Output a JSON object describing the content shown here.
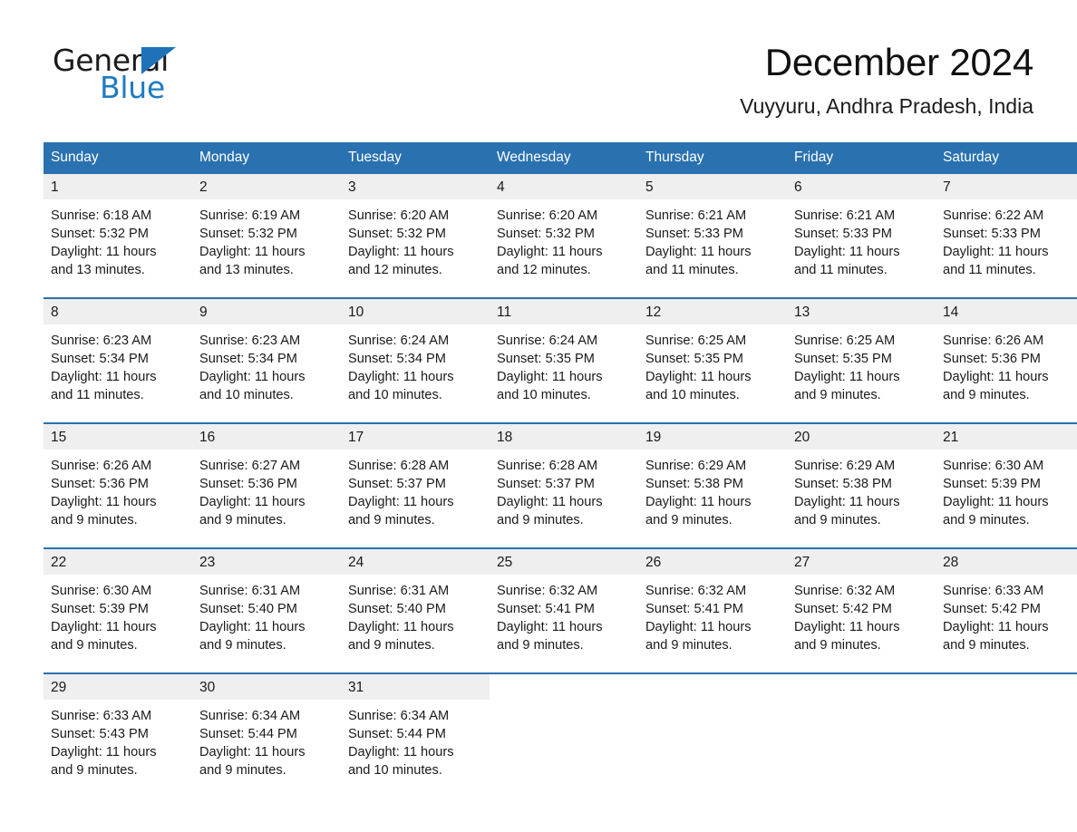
{
  "brand": {
    "word_general": "General",
    "word_blue": "Blue",
    "triangle_color": "#1f72b8",
    "blue_color": "#1f7ac2"
  },
  "header": {
    "title": "December 2024",
    "subtitle": "Vuyyuru, Andhra Pradesh, India"
  },
  "colors": {
    "header_blue": "#2a71b0",
    "daynum_gray": "#efefef",
    "row_divider": "#2a71b0"
  },
  "calendar": {
    "weekday_headers": [
      "Sunday",
      "Monday",
      "Tuesday",
      "Wednesday",
      "Thursday",
      "Friday",
      "Saturday"
    ],
    "weeks": [
      [
        {
          "day": "1",
          "sunrise": "Sunrise: 6:18 AM",
          "sunset": "Sunset: 5:32 PM",
          "daylight_1": "Daylight: 11 hours",
          "daylight_2": "and 13 minutes."
        },
        {
          "day": "2",
          "sunrise": "Sunrise: 6:19 AM",
          "sunset": "Sunset: 5:32 PM",
          "daylight_1": "Daylight: 11 hours",
          "daylight_2": "and 13 minutes."
        },
        {
          "day": "3",
          "sunrise": "Sunrise: 6:20 AM",
          "sunset": "Sunset: 5:32 PM",
          "daylight_1": "Daylight: 11 hours",
          "daylight_2": "and 12 minutes."
        },
        {
          "day": "4",
          "sunrise": "Sunrise: 6:20 AM",
          "sunset": "Sunset: 5:32 PM",
          "daylight_1": "Daylight: 11 hours",
          "daylight_2": "and 12 minutes."
        },
        {
          "day": "5",
          "sunrise": "Sunrise: 6:21 AM",
          "sunset": "Sunset: 5:33 PM",
          "daylight_1": "Daylight: 11 hours",
          "daylight_2": "and 11 minutes."
        },
        {
          "day": "6",
          "sunrise": "Sunrise: 6:21 AM",
          "sunset": "Sunset: 5:33 PM",
          "daylight_1": "Daylight: 11 hours",
          "daylight_2": "and 11 minutes."
        },
        {
          "day": "7",
          "sunrise": "Sunrise: 6:22 AM",
          "sunset": "Sunset: 5:33 PM",
          "daylight_1": "Daylight: 11 hours",
          "daylight_2": "and 11 minutes."
        }
      ],
      [
        {
          "day": "8",
          "sunrise": "Sunrise: 6:23 AM",
          "sunset": "Sunset: 5:34 PM",
          "daylight_1": "Daylight: 11 hours",
          "daylight_2": "and 11 minutes."
        },
        {
          "day": "9",
          "sunrise": "Sunrise: 6:23 AM",
          "sunset": "Sunset: 5:34 PM",
          "daylight_1": "Daylight: 11 hours",
          "daylight_2": "and 10 minutes."
        },
        {
          "day": "10",
          "sunrise": "Sunrise: 6:24 AM",
          "sunset": "Sunset: 5:34 PM",
          "daylight_1": "Daylight: 11 hours",
          "daylight_2": "and 10 minutes."
        },
        {
          "day": "11",
          "sunrise": "Sunrise: 6:24 AM",
          "sunset": "Sunset: 5:35 PM",
          "daylight_1": "Daylight: 11 hours",
          "daylight_2": "and 10 minutes."
        },
        {
          "day": "12",
          "sunrise": "Sunrise: 6:25 AM",
          "sunset": "Sunset: 5:35 PM",
          "daylight_1": "Daylight: 11 hours",
          "daylight_2": "and 10 minutes."
        },
        {
          "day": "13",
          "sunrise": "Sunrise: 6:25 AM",
          "sunset": "Sunset: 5:35 PM",
          "daylight_1": "Daylight: 11 hours",
          "daylight_2": "and 9 minutes."
        },
        {
          "day": "14",
          "sunrise": "Sunrise: 6:26 AM",
          "sunset": "Sunset: 5:36 PM",
          "daylight_1": "Daylight: 11 hours",
          "daylight_2": "and 9 minutes."
        }
      ],
      [
        {
          "day": "15",
          "sunrise": "Sunrise: 6:26 AM",
          "sunset": "Sunset: 5:36 PM",
          "daylight_1": "Daylight: 11 hours",
          "daylight_2": "and 9 minutes."
        },
        {
          "day": "16",
          "sunrise": "Sunrise: 6:27 AM",
          "sunset": "Sunset: 5:36 PM",
          "daylight_1": "Daylight: 11 hours",
          "daylight_2": "and 9 minutes."
        },
        {
          "day": "17",
          "sunrise": "Sunrise: 6:28 AM",
          "sunset": "Sunset: 5:37 PM",
          "daylight_1": "Daylight: 11 hours",
          "daylight_2": "and 9 minutes."
        },
        {
          "day": "18",
          "sunrise": "Sunrise: 6:28 AM",
          "sunset": "Sunset: 5:37 PM",
          "daylight_1": "Daylight: 11 hours",
          "daylight_2": "and 9 minutes."
        },
        {
          "day": "19",
          "sunrise": "Sunrise: 6:29 AM",
          "sunset": "Sunset: 5:38 PM",
          "daylight_1": "Daylight: 11 hours",
          "daylight_2": "and 9 minutes."
        },
        {
          "day": "20",
          "sunrise": "Sunrise: 6:29 AM",
          "sunset": "Sunset: 5:38 PM",
          "daylight_1": "Daylight: 11 hours",
          "daylight_2": "and 9 minutes."
        },
        {
          "day": "21",
          "sunrise": "Sunrise: 6:30 AM",
          "sunset": "Sunset: 5:39 PM",
          "daylight_1": "Daylight: 11 hours",
          "daylight_2": "and 9 minutes."
        }
      ],
      [
        {
          "day": "22",
          "sunrise": "Sunrise: 6:30 AM",
          "sunset": "Sunset: 5:39 PM",
          "daylight_1": "Daylight: 11 hours",
          "daylight_2": "and 9 minutes."
        },
        {
          "day": "23",
          "sunrise": "Sunrise: 6:31 AM",
          "sunset": "Sunset: 5:40 PM",
          "daylight_1": "Daylight: 11 hours",
          "daylight_2": "and 9 minutes."
        },
        {
          "day": "24",
          "sunrise": "Sunrise: 6:31 AM",
          "sunset": "Sunset: 5:40 PM",
          "daylight_1": "Daylight: 11 hours",
          "daylight_2": "and 9 minutes."
        },
        {
          "day": "25",
          "sunrise": "Sunrise: 6:32 AM",
          "sunset": "Sunset: 5:41 PM",
          "daylight_1": "Daylight: 11 hours",
          "daylight_2": "and 9 minutes."
        },
        {
          "day": "26",
          "sunrise": "Sunrise: 6:32 AM",
          "sunset": "Sunset: 5:41 PM",
          "daylight_1": "Daylight: 11 hours",
          "daylight_2": "and 9 minutes."
        },
        {
          "day": "27",
          "sunrise": "Sunrise: 6:32 AM",
          "sunset": "Sunset: 5:42 PM",
          "daylight_1": "Daylight: 11 hours",
          "daylight_2": "and 9 minutes."
        },
        {
          "day": "28",
          "sunrise": "Sunrise: 6:33 AM",
          "sunset": "Sunset: 5:42 PM",
          "daylight_1": "Daylight: 11 hours",
          "daylight_2": "and 9 minutes."
        }
      ],
      [
        {
          "day": "29",
          "sunrise": "Sunrise: 6:33 AM",
          "sunset": "Sunset: 5:43 PM",
          "daylight_1": "Daylight: 11 hours",
          "daylight_2": "and 9 minutes."
        },
        {
          "day": "30",
          "sunrise": "Sunrise: 6:34 AM",
          "sunset": "Sunset: 5:44 PM",
          "daylight_1": "Daylight: 11 hours",
          "daylight_2": "and 9 minutes."
        },
        {
          "day": "31",
          "sunrise": "Sunrise: 6:34 AM",
          "sunset": "Sunset: 5:44 PM",
          "daylight_1": "Daylight: 11 hours",
          "daylight_2": "and 10 minutes."
        },
        {
          "day": "",
          "sunrise": "",
          "sunset": "",
          "daylight_1": "",
          "daylight_2": ""
        },
        {
          "day": "",
          "sunrise": "",
          "sunset": "",
          "daylight_1": "",
          "daylight_2": ""
        },
        {
          "day": "",
          "sunrise": "",
          "sunset": "",
          "daylight_1": "",
          "daylight_2": ""
        },
        {
          "day": "",
          "sunrise": "",
          "sunset": "",
          "daylight_1": "",
          "daylight_2": ""
        }
      ]
    ]
  }
}
